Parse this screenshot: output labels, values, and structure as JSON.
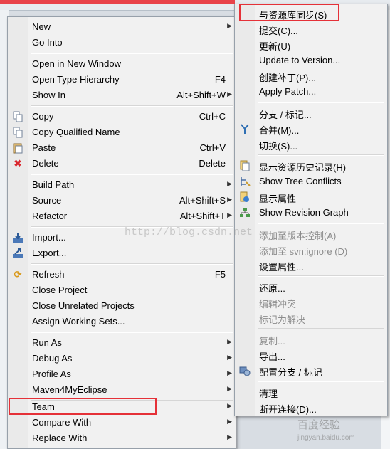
{
  "main_menu": {
    "items": [
      {
        "label": "New",
        "accel": "",
        "arrow": true
      },
      {
        "label": "Go Into",
        "accel": "",
        "arrow": false
      },
      {
        "label": "Open in New Window",
        "accel": "",
        "arrow": false
      },
      {
        "label": "Open Type Hierarchy",
        "accel": "F4",
        "arrow": false
      },
      {
        "label": "Show In",
        "accel": "Alt+Shift+W",
        "arrow": true
      },
      {
        "label": "Copy",
        "accel": "Ctrl+C",
        "arrow": false,
        "icon": "copy-icon"
      },
      {
        "label": "Copy Qualified Name",
        "accel": "",
        "arrow": false,
        "icon": "copy-qualified-icon"
      },
      {
        "label": "Paste",
        "accel": "Ctrl+V",
        "arrow": false,
        "icon": "paste-icon"
      },
      {
        "label": "Delete",
        "accel": "Delete",
        "arrow": false,
        "icon": "delete-icon"
      },
      {
        "label": "Build Path",
        "accel": "",
        "arrow": true
      },
      {
        "label": "Source",
        "accel": "Alt+Shift+S",
        "arrow": true
      },
      {
        "label": "Refactor",
        "accel": "Alt+Shift+T",
        "arrow": true
      },
      {
        "label": "Import...",
        "accel": "",
        "arrow": false,
        "icon": "import-icon"
      },
      {
        "label": "Export...",
        "accel": "",
        "arrow": false,
        "icon": "export-icon"
      },
      {
        "label": "Refresh",
        "accel": "F5",
        "arrow": false,
        "icon": "refresh-icon"
      },
      {
        "label": "Close Project",
        "accel": "",
        "arrow": false
      },
      {
        "label": "Close Unrelated Projects",
        "accel": "",
        "arrow": false
      },
      {
        "label": "Assign Working Sets...",
        "accel": "",
        "arrow": false
      },
      {
        "label": "Run As",
        "accel": "",
        "arrow": true
      },
      {
        "label": "Debug As",
        "accel": "",
        "arrow": true
      },
      {
        "label": "Profile As",
        "accel": "",
        "arrow": true
      },
      {
        "label": "Maven4MyEclipse",
        "accel": "",
        "arrow": true
      },
      {
        "label": "Team",
        "accel": "",
        "arrow": true
      },
      {
        "label": "Compare With",
        "accel": "",
        "arrow": true
      },
      {
        "label": "Replace With",
        "accel": "",
        "arrow": true
      }
    ]
  },
  "team_submenu": {
    "items": [
      {
        "label": "与资源库同步(S)",
        "disabled": false
      },
      {
        "label": "提交(C)...",
        "disabled": false
      },
      {
        "label": "更新(U)",
        "disabled": false
      },
      {
        "label": "Update to Version...",
        "disabled": false
      },
      {
        "label": "创建补丁(P)...",
        "disabled": false
      },
      {
        "label": "Apply Patch...",
        "disabled": false
      },
      {
        "label": "分支 / 标记...",
        "disabled": false
      },
      {
        "label": "合并(M)...",
        "disabled": false,
        "icon": "merge-icon"
      },
      {
        "label": "切换(S)...",
        "disabled": false
      },
      {
        "label": "显示资源历史记录(H)",
        "disabled": false,
        "icon": "history-icon"
      },
      {
        "label": "Show Tree Conflicts",
        "disabled": false,
        "icon": "tree-conflicts-icon"
      },
      {
        "label": "显示属性",
        "disabled": false,
        "icon": "properties-icon"
      },
      {
        "label": "Show Revision Graph",
        "disabled": false,
        "icon": "revision-graph-icon"
      },
      {
        "label": "添加至版本控制(A)",
        "disabled": true
      },
      {
        "label": "添加至 svn:ignore (D)",
        "disabled": true
      },
      {
        "label": "设置属性...",
        "disabled": false
      },
      {
        "label": "还原...",
        "disabled": false
      },
      {
        "label": "编辑冲突",
        "disabled": true
      },
      {
        "label": "标记为解决",
        "disabled": true
      },
      {
        "label": "复制...",
        "disabled": true
      },
      {
        "label": "导出...",
        "disabled": false
      },
      {
        "label": "配置分支 / 标记",
        "disabled": false,
        "icon": "branch-config-icon"
      },
      {
        "label": "清理",
        "disabled": false
      },
      {
        "label": "断开连接(D)...",
        "disabled": false
      }
    ]
  },
  "watermark": {
    "blog": "http://blog.csdn.net",
    "site_cn": "百度经验",
    "site_url": "jingyan.baidu.com"
  },
  "colors": {
    "highlight_border": "#e53138",
    "menu_bg": "#f1f1f1"
  }
}
